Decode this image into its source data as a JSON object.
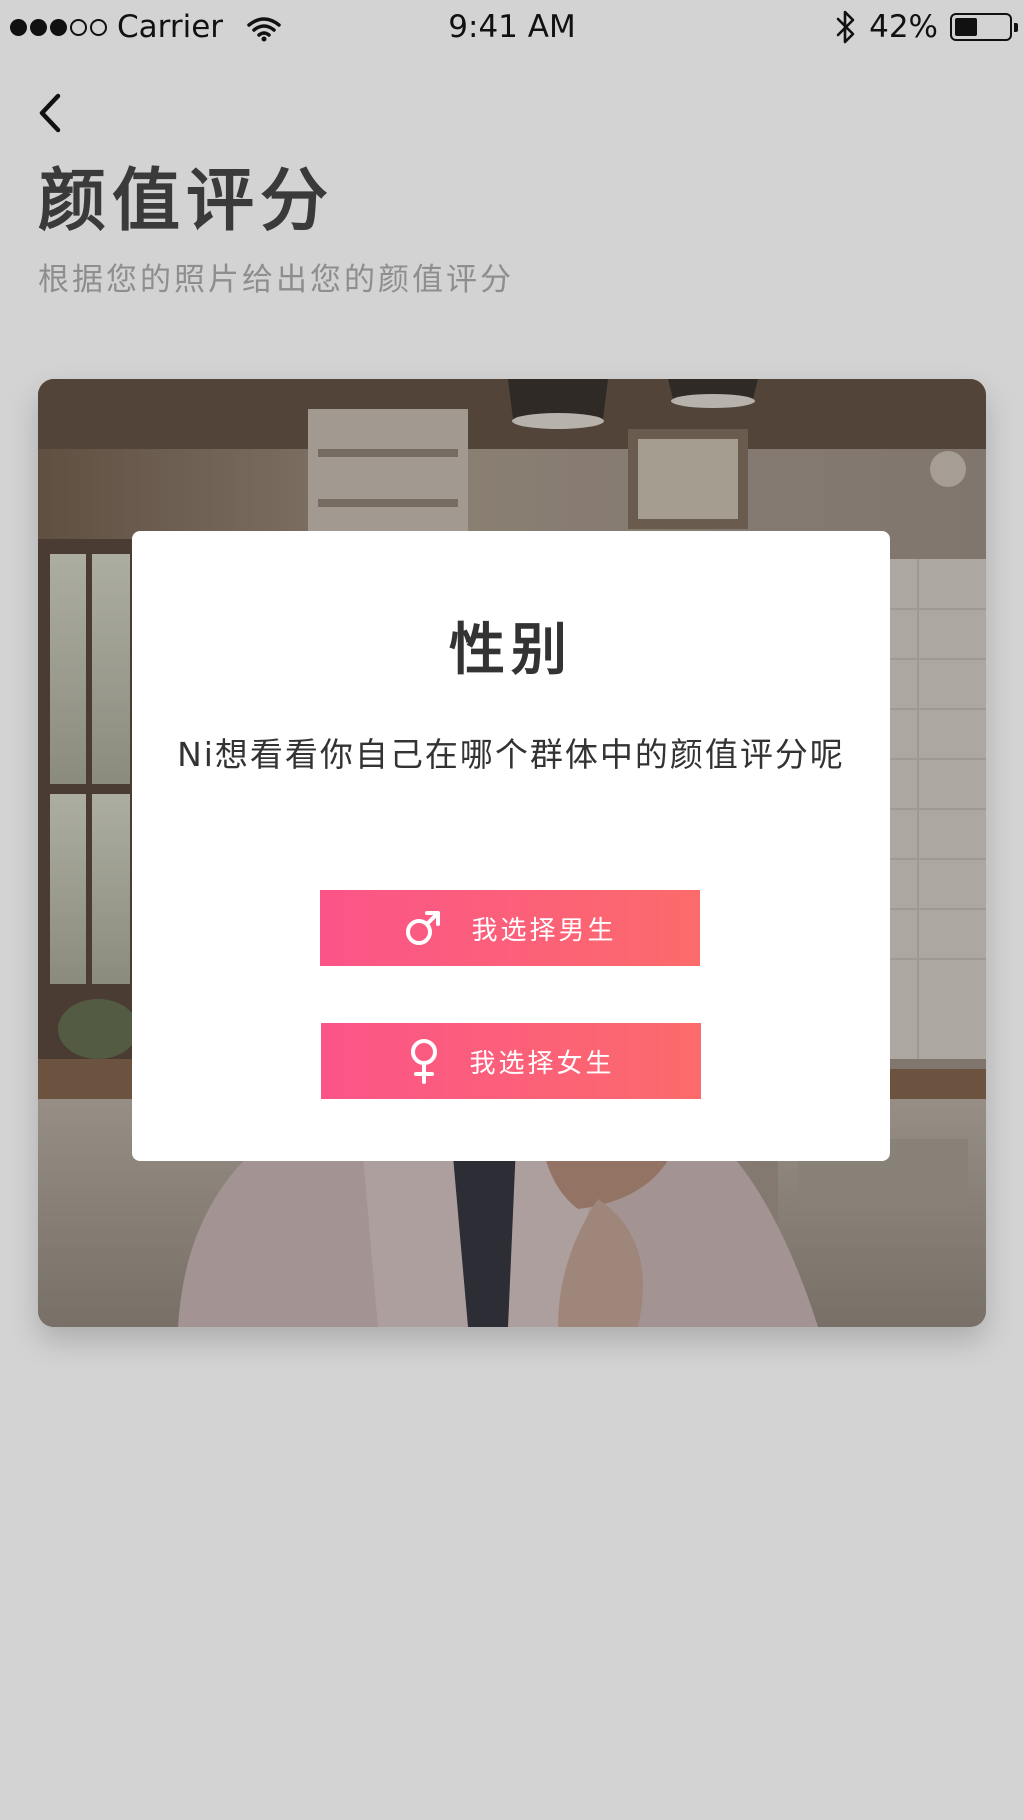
{
  "status_bar": {
    "carrier": "Carrier",
    "time": "9:41 AM",
    "battery_percent": "42%",
    "battery_level": 0.42,
    "signal_filled": 3,
    "signal_total": 5
  },
  "header": {
    "title": "颜值评分",
    "subtitle": "根据您的照片给出您的颜值评分"
  },
  "dialog": {
    "title": "性别",
    "message": "Ni想看看你自己在哪个群体中的颜值评分呢",
    "male_button_label": "我选择男生",
    "female_button_label": "我选择女生",
    "male_icon": "male-symbol-icon",
    "female_icon": "female-symbol-icon"
  },
  "colors": {
    "accent_start": "#fb5489",
    "accent_end": "#fc6b6b",
    "background": "#d3d3d3"
  }
}
